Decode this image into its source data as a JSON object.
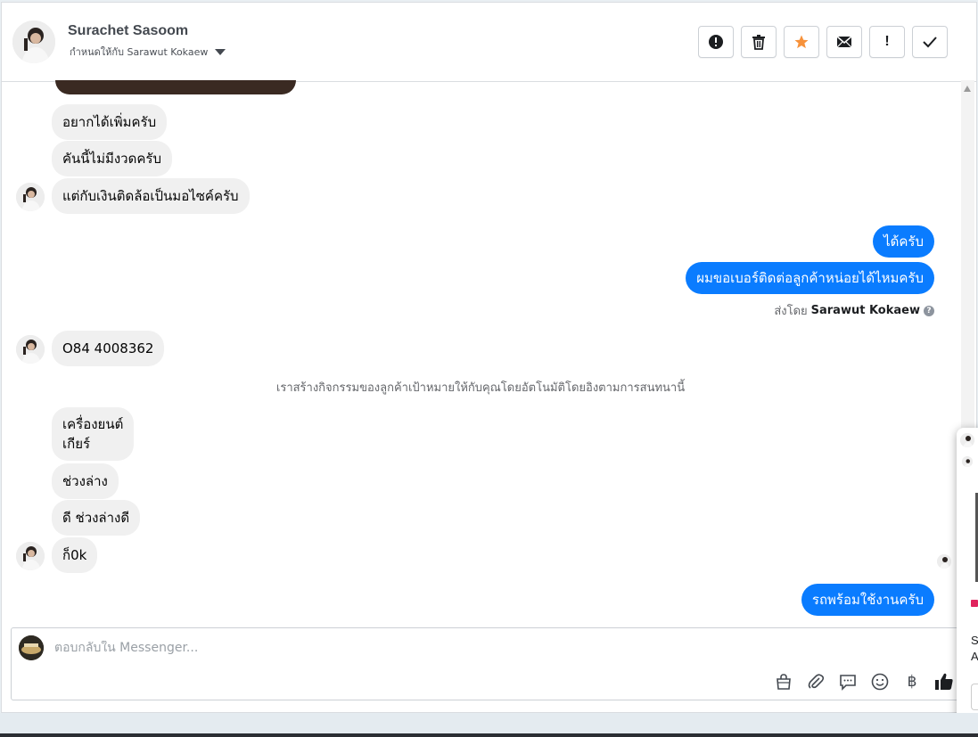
{
  "header": {
    "contact_name": "Surachet Sasoom",
    "assigned_to": "กำหนดให้กับ Sarawut Kokaew",
    "actions": [
      {
        "name": "report-spam",
        "icon": "alert-circle-icon",
        "glyph": "!"
      },
      {
        "name": "delete",
        "icon": "trash-icon",
        "glyph": ""
      },
      {
        "name": "star",
        "icon": "star-icon",
        "glyph": "★"
      },
      {
        "name": "mark-unread",
        "icon": "envelope-icon",
        "glyph": ""
      },
      {
        "name": "follow-up",
        "icon": "exclamation-icon",
        "glyph": "!"
      },
      {
        "name": "mark-done",
        "icon": "check-icon",
        "glyph": "✓"
      }
    ]
  },
  "messages": {
    "in_1": "อยากได้เพิ่มครับ",
    "in_2": "คันนี้ไม่มีงวดครับ",
    "in_3": "แต่กับเงินติดล้อเป็นมอไซค์ครับ",
    "out_1": "ได้ครับ",
    "out_2": "ผมขอเบอร์ติดต่อลูกค้าหน่อยได้ไหมครับ",
    "sent_by_prefix": "ส่งโดย",
    "sent_by_name": "Sarawut Kokaew",
    "in_4": "O84 4008362",
    "system": "เราสร้างกิจกรรมของลูกค้าเป้าหมายให้กับคุณโดยอัตโนมัติโดยอิงตามการสนทนานี้",
    "in_5_line1": "เครื่องยนต์",
    "in_5_line2": "เกียร์",
    "in_6": "ช่วงล่าง",
    "in_7": "ดี ช่วงล่างดี",
    "in_8": "ก็0k",
    "out_3": "รถพร้อมใช้งานครับ"
  },
  "composer": {
    "placeholder": "ตอบกลับใน Messenger...",
    "tools": [
      "shopping-bag-icon",
      "paperclip-icon",
      "chat-bubble-icon",
      "emoji-icon",
      "baht-icon",
      "thumbs-up-icon"
    ],
    "baht_glyph": "฿"
  },
  "colors": {
    "outgoing": "#0a7cff",
    "incoming": "#f0f0f0",
    "star": "#f7923b"
  },
  "side_popup": {
    "text1": "S",
    "text2": "A"
  }
}
